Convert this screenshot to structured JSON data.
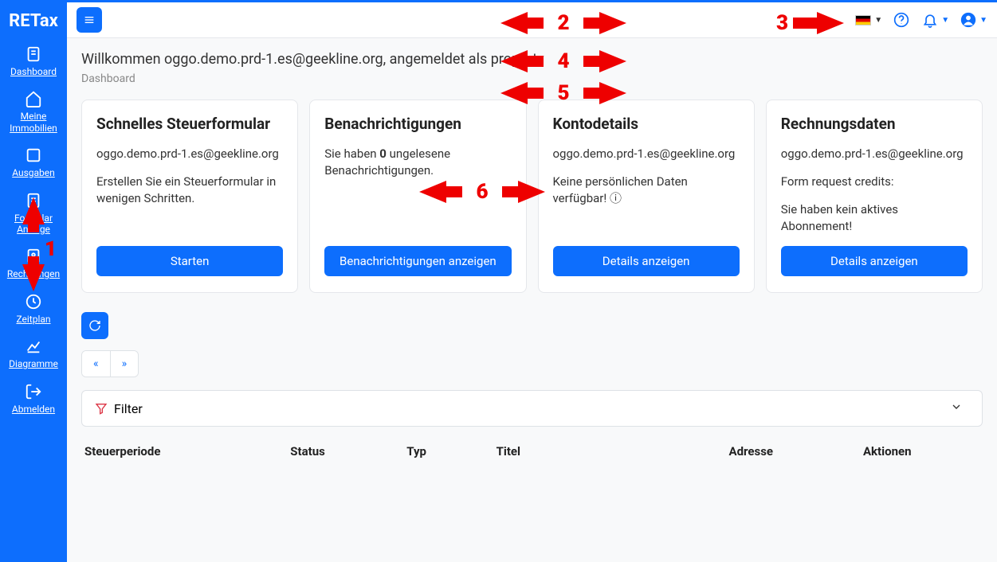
{
  "brand": "RETax",
  "sidebar": {
    "items": [
      {
        "label": "Dashboard"
      },
      {
        "label": "Meine Immobilien"
      },
      {
        "label": "Ausgaben"
      },
      {
        "label": "Formular Anträge"
      },
      {
        "label": "Rechnungen"
      },
      {
        "label": "Zeitplan"
      },
      {
        "label": "Diagramme"
      },
      {
        "label": "Abmelden"
      }
    ]
  },
  "welcome": "Willkommen oggo.demo.prd-1.es@geekline.org, angemeldet als property",
  "breadcrumb": "Dashboard",
  "cards": [
    {
      "title": "Schnelles Steuerformular",
      "line1": "oggo.demo.prd-1.es@geekline.org",
      "line2": "Erstellen Sie ein Steuerformular in wenigen Schritten.",
      "button": "Starten"
    },
    {
      "title": "Benachrichtigungen",
      "line1_pre": "Sie haben ",
      "line1_bold": "0",
      "line1_post": " ungelesene Benachrichtigungen.",
      "button": "Benachrichtigungen anzeigen"
    },
    {
      "title": "Kontodetails",
      "line1": "oggo.demo.prd-1.es@geekline.org",
      "line2": "Keine persönlichen Daten verfügbar! ⓘ",
      "button": "Details anzeigen"
    },
    {
      "title": "Rechnungsdaten",
      "line1": "oggo.demo.prd-1.es@geekline.org",
      "line2": "Form request credits:",
      "line3": "Sie haben kein aktives Abonnement!",
      "button": "Details anzeigen"
    }
  ],
  "pager": {
    "prev": "«",
    "next": "»"
  },
  "filter": {
    "label": "Filter"
  },
  "table": {
    "columns": [
      "Steuerperiode",
      "Status",
      "Typ",
      "Titel",
      "Adresse",
      "Aktionen"
    ]
  },
  "overlays": {
    "n1": "1",
    "n2": "2",
    "n3": "3",
    "n4": "4",
    "n5": "5",
    "n6": "6"
  }
}
